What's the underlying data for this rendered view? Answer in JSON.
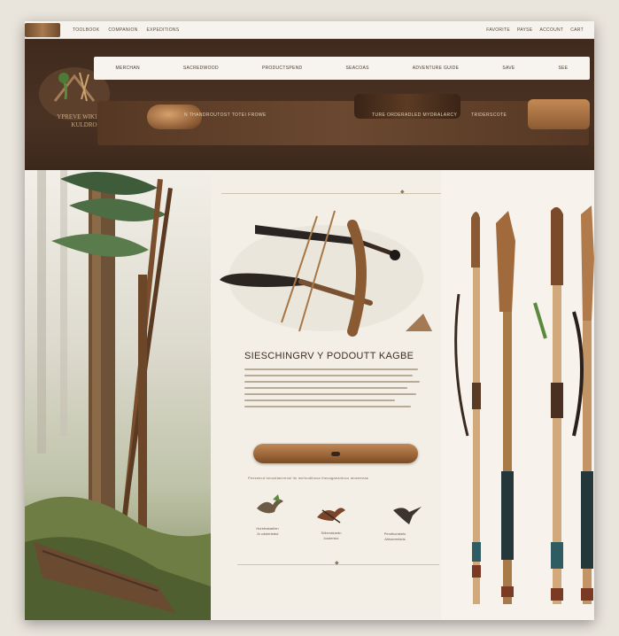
{
  "topbar": {
    "left_links": [
      "TOOLBOOK",
      "COMPANION",
      "EXPEDITIONS"
    ],
    "right_links": [
      "FAVORITE",
      "PAYSE",
      "ACCOUNT",
      "CART"
    ]
  },
  "brand": {
    "name_line1": "YPREVE WIKIRAIT",
    "name_line2": "KULDRO"
  },
  "nav": {
    "items": [
      "MERCHAN",
      "SACREDWOOD",
      "PRODUCTSPEND",
      "SEACOAS",
      "ADVENTURE GUIDE",
      "SAVE",
      "SEE"
    ]
  },
  "promo": {
    "text1": "N THANDROUTOST TOTEI FROWE",
    "text2": "TURE ORDERADLED MYDRALARCY",
    "text3": "TRIDERSCOTE"
  },
  "product": {
    "title": "SIESCHINGRV Y PODOUTT KAGBE",
    "desc_caption": "",
    "note": "Pexseecd tunosfaecrensl ltn mchrodiboxa thecagaeantoco atoseenas",
    "features": [
      {
        "name": "bird-feature",
        "label_1": "Hurefrabarlien",
        "label_2": "Jn cdslertsted"
      },
      {
        "name": "arrow-feature",
        "label_1": "Srllerratuedn",
        "label_2": "Ioodenivc"
      },
      {
        "name": "hawk-feature",
        "label_1": "Perotkcrakelo",
        "label_2": "Ahtoenreleds"
      }
    ]
  },
  "colors": {
    "header_dark": "#3f2a1d",
    "wood_mid": "#9a6437",
    "paper": "#f4efe6",
    "accent_teal": "#2f5c62"
  }
}
